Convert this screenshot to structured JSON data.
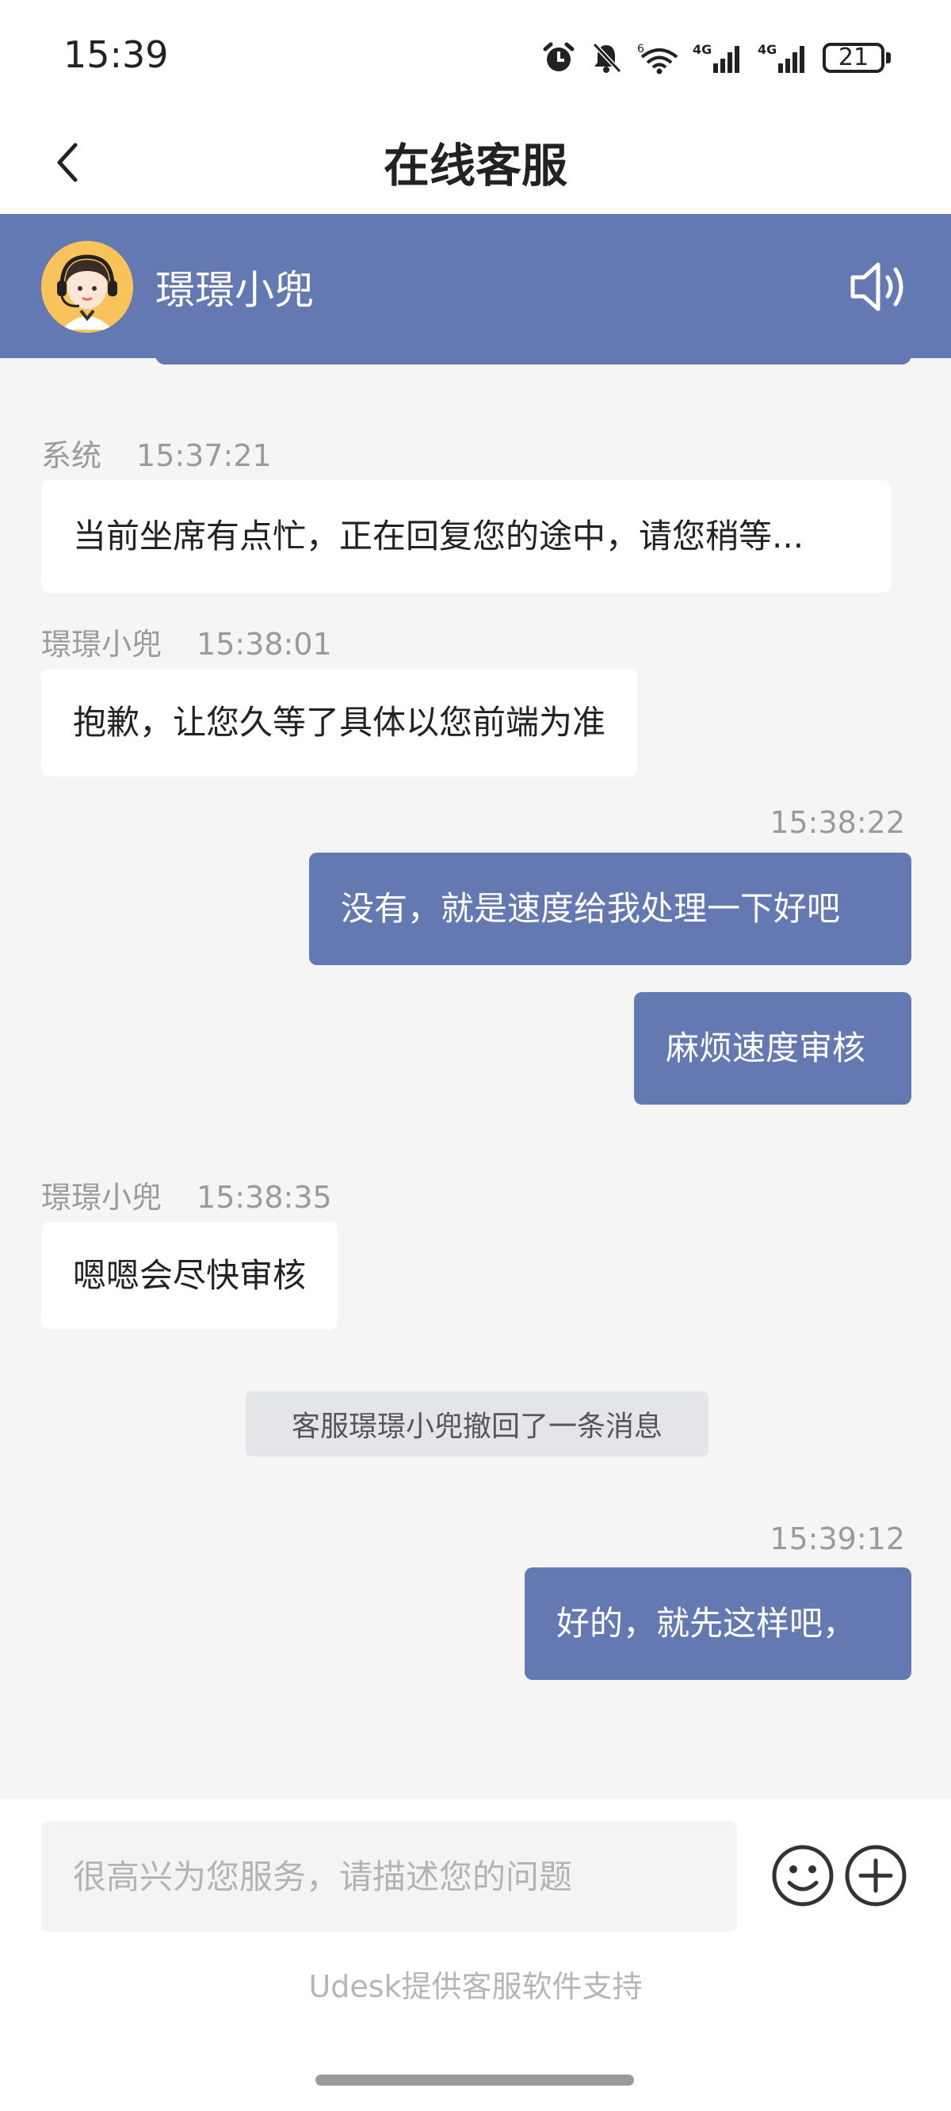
{
  "status_bar": {
    "time": "15:39",
    "network_1": "4G",
    "network_2": "4G",
    "wifi_tag": "6",
    "battery": "21"
  },
  "nav": {
    "title": "在线客服"
  },
  "agent": {
    "name": "璟璟小兜",
    "accent_color": "#6479b2"
  },
  "messages": [
    {
      "sender": "系统",
      "time": "15:37:21",
      "text": "当前坐席有点忙，正在回复您的途中，请您稍等..."
    },
    {
      "sender": "璟璟小兜",
      "time": "15:38:01",
      "text": "抱歉，让您久等了具体以您前端为准"
    },
    {
      "sender": "",
      "time": "15:38:22",
      "text": "没有，就是速度给我处理一下好吧"
    },
    {
      "sender": "",
      "time": "",
      "text": "麻烦速度审核"
    },
    {
      "sender": "璟璟小兜",
      "time": "15:38:35",
      "text": "嗯嗯会尽快审核"
    },
    {
      "sender": "",
      "time": "15:39:12",
      "text": "好的，就先这样吧，"
    }
  ],
  "recall_notice": "客服璟璟小兜撤回了一条消息",
  "input": {
    "placeholder": "很高兴为您服务，请描述您的问题",
    "value": ""
  },
  "footer": {
    "powered_by": "Udesk提供客服软件支持"
  },
  "icons": [
    "alarm-icon",
    "bell-off-icon",
    "wifi-icon",
    "signal-icon",
    "battery-icon",
    "back-icon",
    "avatar",
    "speaker-icon",
    "emoji-icon",
    "plus-icon"
  ]
}
